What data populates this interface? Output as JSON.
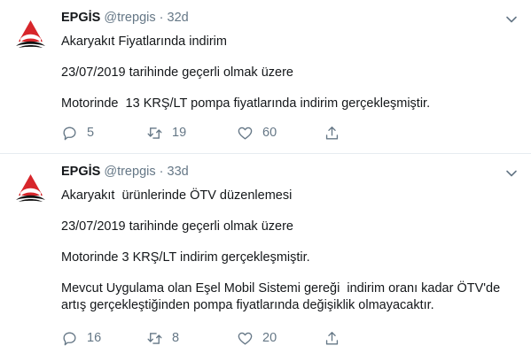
{
  "tweets": [
    {
      "name": "EPGİS",
      "handle": "@trepgis",
      "dot": "·",
      "time": "32d",
      "lines": [
        "Akaryakıt Fiyatlarında indirim",
        "23/07/2019 tarihinde geçerli olmak üzere",
        "Motorinde  13 KRŞ/LT pompa fiyatlarında indirim gerçekleşmiştir."
      ],
      "replies": "5",
      "retweets": "19",
      "likes": "60"
    },
    {
      "name": "EPGİS",
      "handle": "@trepgis",
      "dot": "·",
      "time": "33d",
      "lines": [
        "Akaryakıt  ürünlerinde ÖTV düzenlemesi",
        "23/07/2019 tarihinde geçerli olmak üzere",
        "Motorinde 3 KRŞ/LT indirim gerçekleşmiştir.",
        "Mevcut Uygulama olan Eşel Mobil Sistemi gereği  indirim oranı kadar ÖTV'de artış gerçekleştiğinden pompa fiyatlarında değişiklik olmayacaktır."
      ],
      "replies": "16",
      "retweets": "8",
      "likes": "20"
    }
  ],
  "icons": {
    "avatar": "epgis-logo-icon",
    "caret": "chevron-down-icon",
    "reply": "reply-icon",
    "retweet": "retweet-icon",
    "like": "heart-icon",
    "share": "share-icon"
  },
  "colors": {
    "text": "#14171a",
    "secondary": "#657786",
    "logo_red": "#d7262b",
    "divider": "#e6ecf0"
  }
}
